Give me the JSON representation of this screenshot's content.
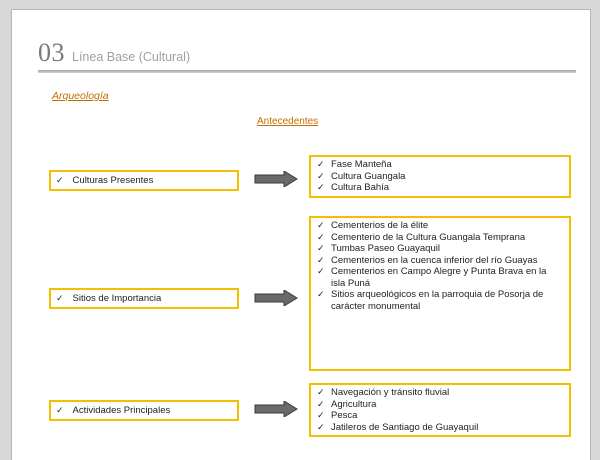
{
  "header": {
    "number": "03",
    "title": "Línea Base (Cultural)"
  },
  "section_title": "Arqueología",
  "subtitle": "Antecedentes",
  "check_mark": "✓",
  "rows": [
    {
      "label": "Culturas Presentes",
      "items": [
        "Fase Manteña",
        "Cultura Guangala",
        "Cultura Bahía"
      ]
    },
    {
      "label": "Sitios de Importancia",
      "items": [
        "Cementerios de la élite",
        "Cementerio de la Cultura Guangala Temprana",
        "Tumbas Paseo Guayaquil",
        "Cementerios en la cuenca inferior del río Guayas",
        "Cementerios en Campo Alegre y Punta Brava en la isla Puná",
        "Sitios arqueológicos en la parroquia de Posorja de carácter monumental"
      ]
    },
    {
      "label": "Actividades Principales",
      "items": [
        "Navegación y tránsito fluvial",
        "Agricultura",
        "Pesca",
        "Jatileros de Santiago de Guayaquil"
      ]
    }
  ]
}
